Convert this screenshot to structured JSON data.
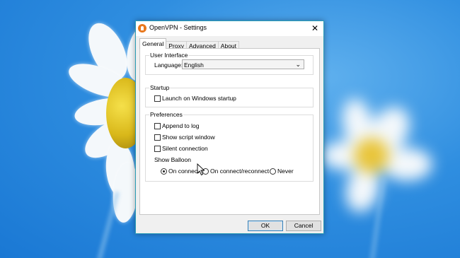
{
  "window": {
    "title": "OpenVPN - Settings",
    "close_glyph": "✕"
  },
  "tabs": [
    {
      "label": "General",
      "active": true
    },
    {
      "label": "Proxy"
    },
    {
      "label": "Advanced"
    },
    {
      "label": "About"
    }
  ],
  "user_interface": {
    "title": "User Interface",
    "language_label": "Language:",
    "language_value": "English"
  },
  "startup": {
    "title": "Startup",
    "launch_label": "Launch on Windows startup"
  },
  "preferences": {
    "title": "Preferences",
    "append_log": "Append to log",
    "show_script": "Show script window",
    "silent": "Silent connection",
    "show_balloon": "Show Balloon",
    "on_connect": "On connect",
    "on_reconnect": "On connect/reconnect",
    "never": "Never"
  },
  "buttons": {
    "ok": "OK",
    "cancel": "Cancel"
  },
  "icons": {
    "app": "openvpn-icon",
    "close": "close-icon",
    "dropdown": "chevron-down-icon",
    "cursor": "mouse-cursor-icon"
  },
  "colors": {
    "window_border": "#2a9db6",
    "desktop": "#2f8ee0",
    "default_button_border": "#3c7fb1"
  }
}
